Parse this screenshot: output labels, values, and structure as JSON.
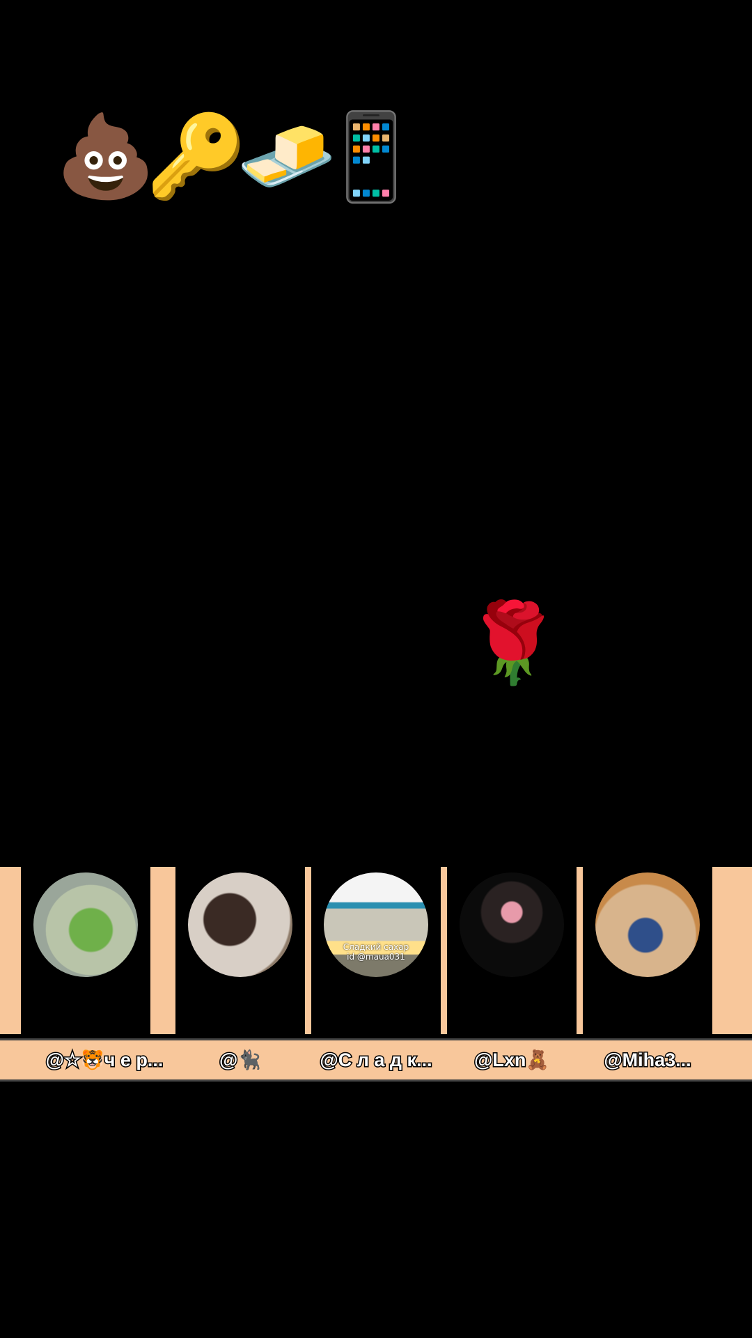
{
  "gifts": [
    {
      "emoji": "💩",
      "icon": "poo-icon"
    },
    {
      "emoji": "🔑",
      "icon": "car-key-icon"
    },
    {
      "emoji": "🧈",
      "icon": "gold-bar-icon"
    },
    {
      "emoji": "📱",
      "icon": "mobile-phone-icon"
    }
  ],
  "floating_gift": {
    "emoji": "🌹",
    "icon": "rose-icon"
  },
  "users": [
    {
      "name": "@☆🐯ч е р...",
      "avatar_caption": ""
    },
    {
      "name": "@🐈‍⬛",
      "avatar_caption": ""
    },
    {
      "name": "@С л а д к...",
      "avatar_caption": "Сладкий сахар\nid @maua031"
    },
    {
      "name": "@Lxn🧸",
      "avatar_caption": ""
    },
    {
      "name": "@Miha3...",
      "avatar_caption": ""
    }
  ],
  "colors": {
    "background": "#000000",
    "strip": "#f8c79b"
  }
}
